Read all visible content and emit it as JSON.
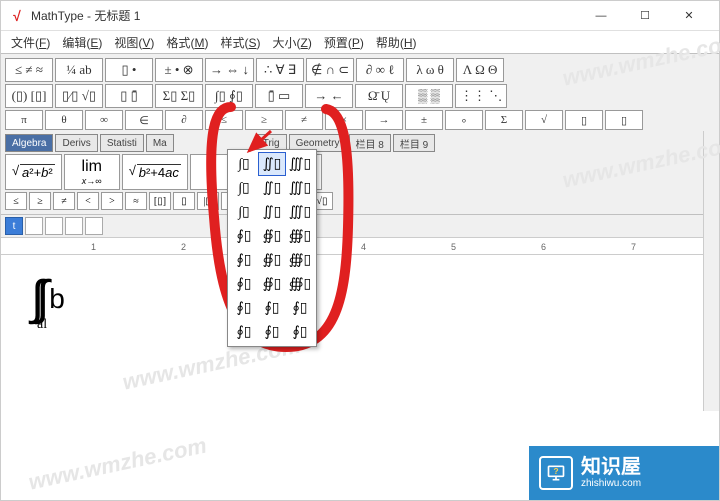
{
  "window": {
    "app_icon": "√",
    "title": "MathType - 无标题 1",
    "min": "—",
    "max": "☐",
    "close": "✕"
  },
  "menubar": [
    {
      "label": "文件",
      "key": "F"
    },
    {
      "label": "编辑",
      "key": "E"
    },
    {
      "label": "视图",
      "key": "V"
    },
    {
      "label": "格式",
      "key": "M"
    },
    {
      "label": "样式",
      "key": "S"
    },
    {
      "label": "大小",
      "key": "Z"
    },
    {
      "label": "预置",
      "key": "P"
    },
    {
      "label": "帮助",
      "key": "H"
    }
  ],
  "toolbar_row1": [
    "≤ ≠ ≈",
    "¼ ab",
    "▯ •",
    "± • ⊗",
    "→ ⇔ ↓",
    "∴ ∀ ∃",
    "∉ ∩ ⊂",
    "∂ ∞ ℓ",
    "λ ω θ",
    "Λ Ω Θ"
  ],
  "toolbar_row2": [
    "(▯) [▯]",
    "▯⁄▯ √▯",
    "▯ ▯̄",
    "Σ▯ Σ▯",
    "∫▯ ∮▯",
    "▯̄ ▭",
    "→ ←",
    "Ω̄ Ų",
    "▒ ▒",
    "⋮⋮ ⋱"
  ],
  "toolbar_row3": [
    "π",
    "θ",
    "∞",
    "∈",
    "∂",
    "≤",
    "≥",
    "≠",
    "×",
    "→",
    "±",
    "∘",
    "Σ",
    "√",
    "▯",
    "▯",
    "▯",
    "▯"
  ],
  "tabs": [
    "Algebra",
    "Derivs",
    "Statisti",
    "Ma",
    "Trig",
    "Geometry",
    "栏目 8",
    "栏目 9"
  ],
  "tabs_active_index": 0,
  "templates": [
    "√(a²+b²)",
    "lim x→∞",
    "√(b²+4ac)",
    "",
    "½"
  ],
  "mini_row": [
    "≤",
    "≥",
    "≠",
    "<",
    ">",
    "≈",
    "[▯]",
    "▯",
    "|▯|",
    "",
    "(▯+r)",
    "",
    "√▯",
    ""
  ],
  "small_toolbar": [
    "t",
    "",
    "",
    "",
    ""
  ],
  "dropdown": {
    "rows": [
      [
        "∫▯",
        "∬▯",
        "∭▯"
      ],
      [
        "∫▯",
        "∬▯",
        "∭▯"
      ],
      [
        "∫▯",
        "∬▯",
        "∭▯"
      ],
      [
        "∮▯",
        "∯▯",
        "∰▯"
      ],
      [
        "∮▯",
        "∯▯",
        "∰▯"
      ],
      [
        "∮▯",
        "∯▯",
        "∰▯"
      ],
      [
        "∮▯",
        "∮▯",
        "∮▯"
      ],
      [
        "∮▯",
        "∮▯",
        "∮▯"
      ]
    ],
    "selected": {
      "row": 0,
      "col": 1
    }
  },
  "equation": {
    "integral": "∫∫",
    "lower": "al",
    "body": "b"
  },
  "ruler": {
    "marks": [
      "1",
      "2",
      "3",
      "4",
      "5",
      "6",
      "7"
    ]
  },
  "watermark": "www.wmzhe.com",
  "footer": {
    "cn": "知识屋",
    "en": "zhishiwu.com",
    "icon": "?"
  }
}
